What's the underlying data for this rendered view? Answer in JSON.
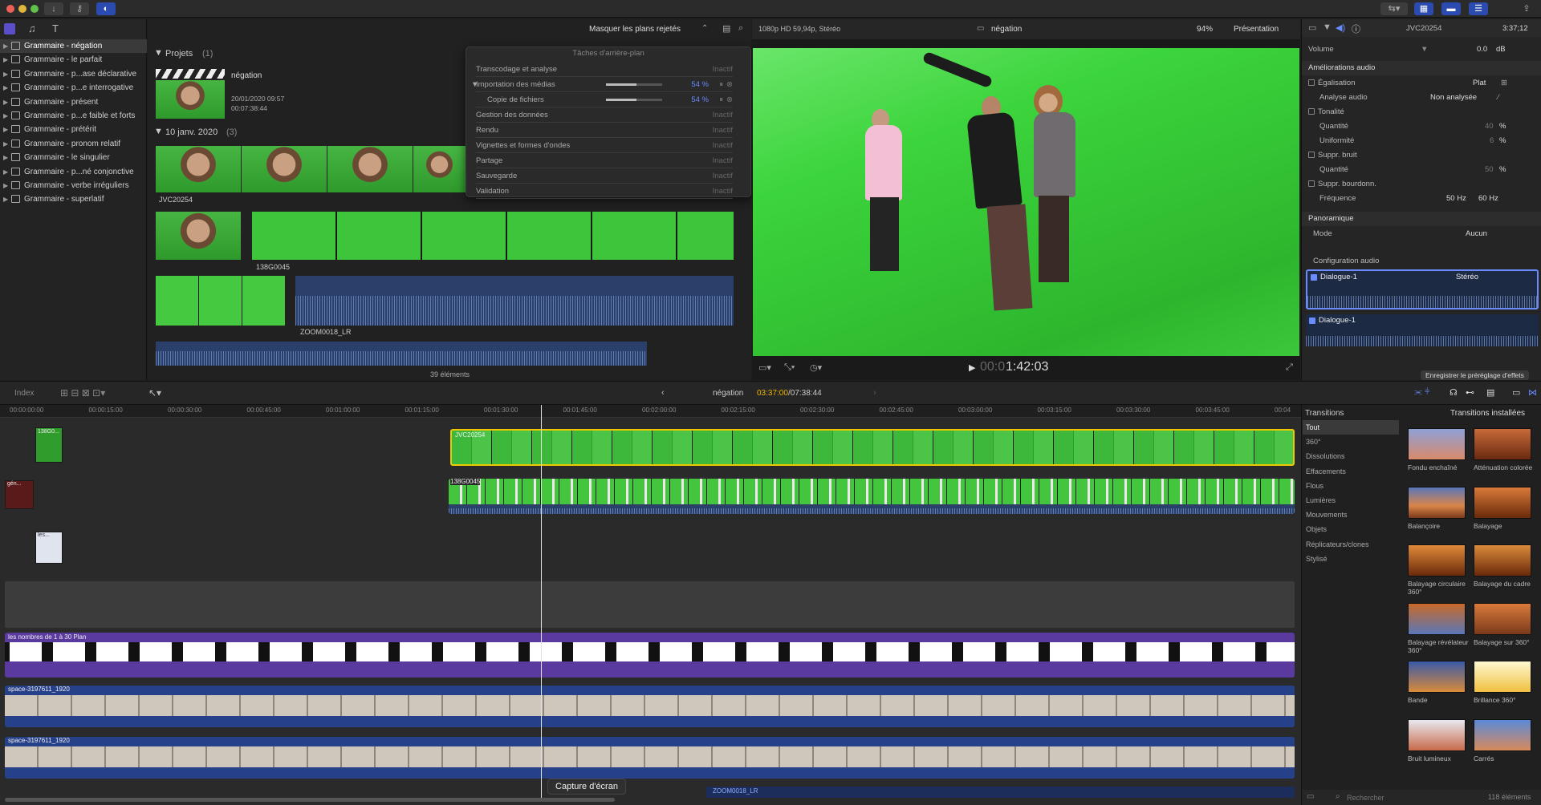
{
  "toolbar": {
    "icons": [
      "import-icon",
      "key-icon",
      "contrast-icon"
    ]
  },
  "library": {
    "items": [
      {
        "label": "Grammaire - négation",
        "selected": true
      },
      {
        "label": "Grammaire - le parfait"
      },
      {
        "label": "Grammaire - p...ase déclarative"
      },
      {
        "label": "Grammaire - p...e interrogative"
      },
      {
        "label": "Grammaire - présent"
      },
      {
        "label": "Grammaire - p...e faible et forts"
      },
      {
        "label": "Grammaire - prétérit"
      },
      {
        "label": "Grammaire - pronom relatif"
      },
      {
        "label": "Grammaire - le singulier"
      },
      {
        "label": "Grammaire - p...né conjonctive"
      },
      {
        "label": "Grammaire - verbe irréguliers"
      },
      {
        "label": "Grammaire - superlatif"
      }
    ]
  },
  "browser": {
    "filter_label": "Masquer les plans rejetés",
    "projects_header": "Projets",
    "projects_count": "(1)",
    "project_name": "négation",
    "project_date": "20/01/2020 09:57",
    "project_duration": "00:07:38:44",
    "event_header": "10 janv. 2020",
    "event_count": "(3)",
    "clip1": "JVC20254",
    "clip2": "138G0045",
    "clip3": "ZOOM0018_LR",
    "count": "39 éléments"
  },
  "bgtasks": {
    "title": "Tâches d'arrière-plan",
    "rows": [
      {
        "label": "Transcodage et analyse",
        "status": "Inactif"
      },
      {
        "label": "Importation des médias",
        "status": "54 %"
      },
      {
        "label": "Copie de fichiers",
        "status": "54 %"
      },
      {
        "label": "Gestion des données",
        "status": "Inactif"
      },
      {
        "label": "Rendu",
        "status": "Inactif"
      },
      {
        "label": "Vignettes et formes d'ondes",
        "status": "Inactif"
      },
      {
        "label": "Partage",
        "status": "Inactif"
      },
      {
        "label": "Sauvegarde",
        "status": "Inactif"
      },
      {
        "label": "Validation",
        "status": "Inactif"
      }
    ]
  },
  "viewer": {
    "format": "1080p HD 59,94p, Stéréo",
    "title": "négation",
    "zoom": "94%",
    "presentation": "Présentation",
    "timecode_dim": "00:0",
    "timecode": "1:42:03"
  },
  "inspector": {
    "clip": "JVC20254",
    "duration": "3:37;12",
    "volume_label": "Volume",
    "volume_value": "0.0",
    "volume_unit": "dB",
    "enh_header": "Améliorations audio",
    "eq_label": "Égalisation",
    "eq_value": "Plat",
    "analysis_label": "Analyse audio",
    "analysis_value": "Non analysée",
    "tone_label": "Tonalité",
    "qty_label": "Quantité",
    "qty_value": "40",
    "unif_label": "Uniformité",
    "unif_value": "6",
    "noise_label": "Suppr. bruit",
    "qty2_label": "Quantité",
    "qty2_value": "50",
    "hum_label": "Suppr. bourdonn.",
    "freq_label": "Fréquence",
    "freq1": "50 Hz",
    "freq2": "60 Hz",
    "pan_header": "Panoramique",
    "mode_label": "Mode",
    "mode_value": "Aucun",
    "config_header": "Configuration audio",
    "dialog1": "Dialogue-1",
    "stereo": "Stéréo",
    "dialog2": "Dialogue-1",
    "save_preset": "Enregistrer le préréglage d'effets",
    "pct": "%"
  },
  "timeline": {
    "index_label": "Index",
    "project": "négation",
    "tc_current": "03:37:00",
    "tc_total": "/07:38:44",
    "ruler": [
      "00:00:00:00",
      "00:00:15:00",
      "00:00:30:00",
      "00:00:45:00",
      "00:01:00:00",
      "00:01:15:00",
      "00:01:30:00",
      "00:01:45:00",
      "00:02:00:00",
      "00:02:15:00",
      "00:02:30:00",
      "00:02:45:00",
      "00:03:00:00",
      "00:03:15:00",
      "00:03:30:00",
      "00:03:45:00",
      "00:04"
    ],
    "clipA": "JVC20254",
    "clipB": "138G0045",
    "purple": "les nombres de 1 à 30 Plan",
    "space1": "space-3197611_1920",
    "space2": "space-3197611_1920",
    "zoom_bottom": "ZOOM0018_LR",
    "conn1": "138G0...",
    "conn2": "gén...",
    "conn3": "les..."
  },
  "transitions": {
    "header": "Transitions",
    "installed": "Transitions installées",
    "categories": [
      "Tout",
      "360°",
      "Dissolutions",
      "Effacements",
      "Flous",
      "Lumières",
      "Mouvements",
      "Objets",
      "Réplicateurs/clones",
      "Stylisé"
    ],
    "items": [
      {
        "label": "Fondu enchaîné"
      },
      {
        "label": "Atténuation colorée"
      },
      {
        "label": "Balançoire"
      },
      {
        "label": "Balayage"
      },
      {
        "label": "Balayage circulaire 360°"
      },
      {
        "label": "Balayage du cadre"
      },
      {
        "label": "Balayage révélateur 360°"
      },
      {
        "label": "Balayage sur 360°"
      },
      {
        "label": "Bande"
      },
      {
        "label": "Brillance 360°"
      },
      {
        "label": "Bruit lumineux"
      },
      {
        "label": "Carrés"
      }
    ],
    "search_placeholder": "Rechercher",
    "count": "118 éléments"
  },
  "tooltip": "Capture d'écran"
}
